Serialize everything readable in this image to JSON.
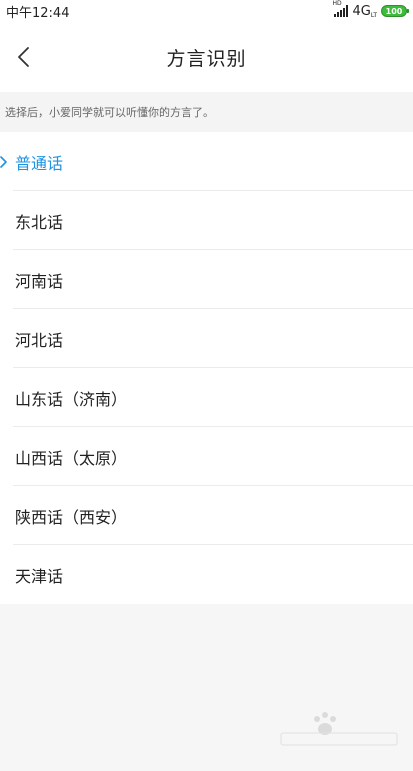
{
  "status_bar": {
    "time": "中午12:44",
    "hd": "HD",
    "network": "4G",
    "network_sub": "LT",
    "battery": "100"
  },
  "header": {
    "title": "方言识别",
    "back_icon": "chevron-left-icon"
  },
  "description": "选择后，小爱同学就可以听懂你的方言了。",
  "dialects": [
    {
      "label": "普通话",
      "selected": true
    },
    {
      "label": "东北话",
      "selected": false
    },
    {
      "label": "河南话",
      "selected": false
    },
    {
      "label": "河北话",
      "selected": false
    },
    {
      "label": "山东话（济南）",
      "selected": false
    },
    {
      "label": "山西话（太原）",
      "selected": false
    },
    {
      "label": "陕西话（西安）",
      "selected": false
    },
    {
      "label": "天津话",
      "selected": false
    }
  ],
  "colors": {
    "accent": "#1f93e0",
    "battery": "#3dbb3a",
    "background": "#f6f6f6"
  }
}
